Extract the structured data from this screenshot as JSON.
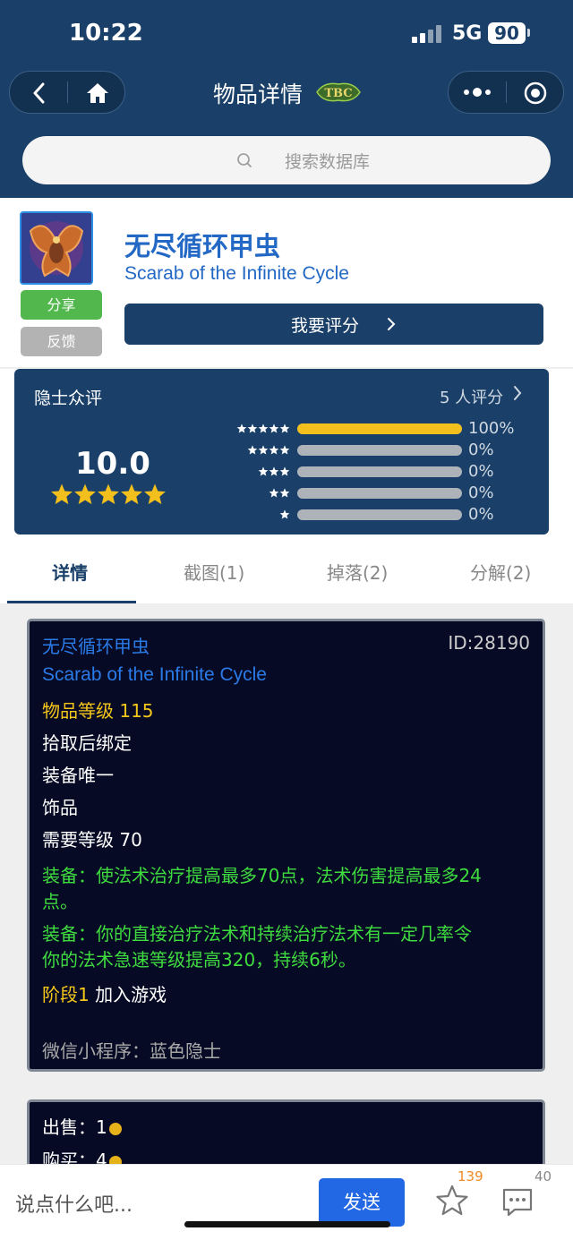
{
  "status_bar": {
    "time": "10:22",
    "network": "5G",
    "battery": "90"
  },
  "nav": {
    "title": "物品详情",
    "logo": "TBC"
  },
  "search": {
    "placeholder": "搜索数据库"
  },
  "item": {
    "name_cn": "无尽循环甲虫",
    "name_en": "Scarab of the Infinite Cycle",
    "share_label": "分享",
    "feedback_label": "反馈",
    "rate_label": "我要评分"
  },
  "rating": {
    "label": "隐士众评",
    "count_text": "5 人评分",
    "score": "10.0",
    "stars": 5,
    "distribution": [
      {
        "stars": 5,
        "percent": 100,
        "text": "100%"
      },
      {
        "stars": 4,
        "percent": 0,
        "text": "0%"
      },
      {
        "stars": 3,
        "percent": 0,
        "text": "0%"
      },
      {
        "stars": 2,
        "percent": 0,
        "text": "0%"
      },
      {
        "stars": 1,
        "percent": 0,
        "text": "0%"
      }
    ]
  },
  "tabs": [
    {
      "label": "详情",
      "active": true
    },
    {
      "label": "截图(1)",
      "active": false
    },
    {
      "label": "掉落(2)",
      "active": false
    },
    {
      "label": "分解(2)",
      "active": false
    }
  ],
  "tooltip": {
    "name_cn": "无尽循环甲虫",
    "id": "ID:28190",
    "name_en": "Scarab of the Infinite Cycle",
    "item_level": "物品等级 115",
    "bind": "拾取后绑定",
    "unique": "装备唯一",
    "slot": "饰品",
    "req_level": "需要等级 70",
    "equip1_line1": "装备：使法术治疗提高最多70点，法术伤害提高最多24",
    "equip1_line2": "点。",
    "equip2_line1": "装备：你的直接治疗法术和持续治疗法术有一定几率令",
    "equip2_line2": "你的法术急速等级提高320，持续6秒。",
    "phase_label": "阶段1",
    "phase_text": "加入游戏",
    "source": "微信小程序：蓝色隐士"
  },
  "price": {
    "sell_label": "出售：",
    "sell_value": "1",
    "buy_label": "购买：",
    "buy_value": "4"
  },
  "bottom": {
    "placeholder": "说点什么吧...",
    "send": "发送",
    "fav_count": "139",
    "comment_count": "40"
  },
  "colors": {
    "header": "#1a4069",
    "accent_blue": "#2268c4",
    "gold": "#f2bf1c",
    "green": "#3fdc3f"
  }
}
